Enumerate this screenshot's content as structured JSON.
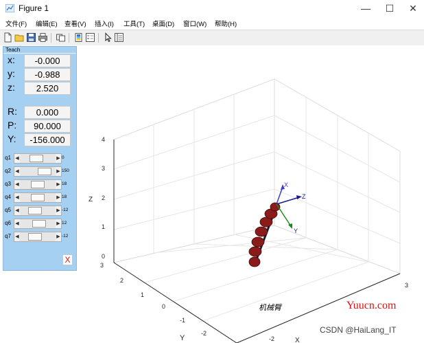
{
  "window": {
    "title": "Figure 1",
    "controls": {
      "minimize": "—",
      "maximize": "☐",
      "close": "✕"
    }
  },
  "menu": [
    {
      "label": "文件(F)"
    },
    {
      "label": "编辑(E)"
    },
    {
      "label": "查看(V)"
    },
    {
      "label": "插入(I)"
    },
    {
      "label": "工具(T)"
    },
    {
      "label": "桌面(D)"
    },
    {
      "label": "窗口(W)"
    },
    {
      "label": "帮助(H)"
    }
  ],
  "toolbar": {
    "icons": [
      "new-figure-icon",
      "open-file-icon",
      "save-icon",
      "print-icon",
      "link-icon",
      "insert-colorbar-icon",
      "insert-legend-icon",
      "select-pointer-icon",
      "property-inspector-icon"
    ]
  },
  "teach": {
    "title": "Teach",
    "position": [
      {
        "label": "x:",
        "value": "-0.000"
      },
      {
        "label": "y:",
        "value": "-0.988"
      },
      {
        "label": "z:",
        "value": "2.520"
      }
    ],
    "orientation": [
      {
        "label": "R:",
        "value": "0.000"
      },
      {
        "label": "P:",
        "value": "90.000"
      },
      {
        "label": "Y:",
        "value": "-156.000"
      }
    ],
    "joints": [
      {
        "label": "q1",
        "value": "0"
      },
      {
        "label": "q2",
        "value": "150"
      },
      {
        "label": "q3",
        "value": "18"
      },
      {
        "label": "q4",
        "value": "18"
      },
      {
        "label": "q5",
        "value": "-12"
      },
      {
        "label": "q6",
        "value": "12"
      },
      {
        "label": "q7",
        "value": "-12"
      }
    ],
    "close_label": "X"
  },
  "plot": {
    "z_label": "Z",
    "y_label": "Y",
    "x_label": "X",
    "z_ticks": [
      "4",
      "3",
      "2",
      "1",
      "0"
    ],
    "y_ticks": [
      "3",
      "2",
      "1",
      "0",
      "-1",
      "-2"
    ],
    "x_ticks": [
      "3",
      "-2"
    ],
    "frame_labels": {
      "x": "X",
      "y": "Y",
      "z": "Z"
    },
    "robot_name": "机械臂",
    "colors": {
      "grid": "#e6e6e6",
      "axis": "#262626",
      "link": "#8b1a1a",
      "frame_x": "#3b3bd1",
      "frame_y": "#1a8a1a",
      "frame_z": "#1a1a8a"
    }
  },
  "watermarks": {
    "site": "Yuucn.com",
    "author": "CSDN @HaiLang_IT"
  }
}
